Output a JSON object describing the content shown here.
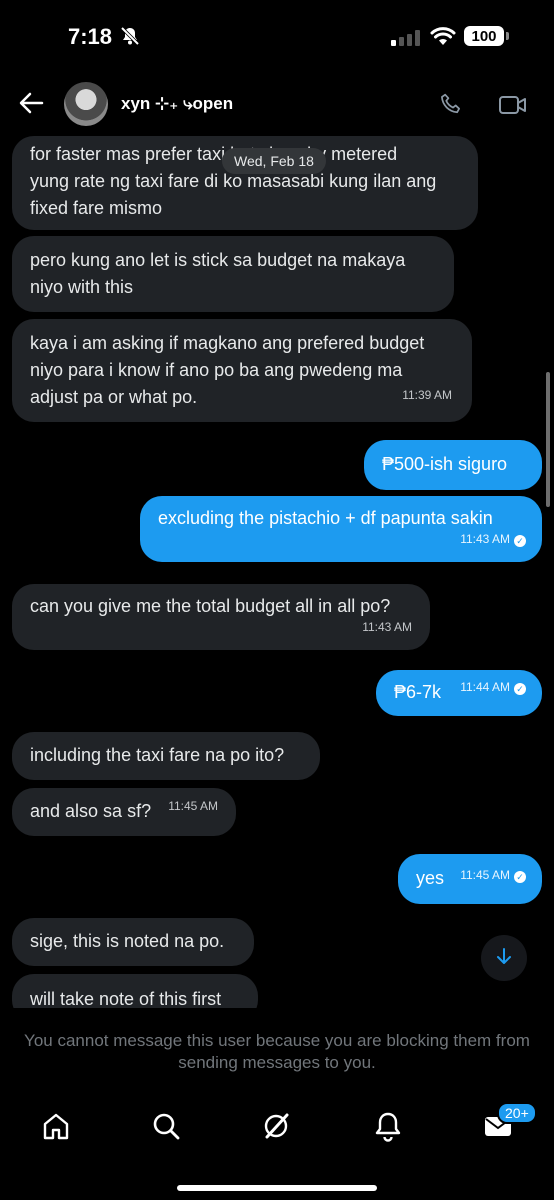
{
  "status": {
    "time": "7:18",
    "battery": "100"
  },
  "header": {
    "name": "xyn ⊹₊ ⤷open"
  },
  "date_divider": "Wed, Feb 18",
  "messages": [
    {
      "lines": [
        "for faster mas prefer taxi but since by metered",
        "yung rate ng taxi fare di ko masasabi kung ilan ang",
        "fixed fare mismo"
      ],
      "time": ""
    },
    {
      "lines": [
        "pero kung ano let is stick sa budget na makaya",
        "niyo with this"
      ],
      "time": ""
    },
    {
      "lines": [
        "kaya i am asking if magkano ang prefered budget",
        "niyo para i know if ano po ba ang pwedeng ma",
        "adjust pa or what po."
      ],
      "time": "11:39 AM"
    },
    {
      "lines": [
        "₱500-ish siguro"
      ],
      "time": ""
    },
    {
      "lines": [
        "excluding the pistachio + df papunta sakin"
      ],
      "time": "11:43 AM"
    },
    {
      "lines": [
        "can you give me the total budget all in all po?"
      ],
      "time": "11:43 AM"
    },
    {
      "lines": [
        "₱6-7k"
      ],
      "time": "11:44 AM"
    },
    {
      "lines": [
        "including the taxi fare na po ito?"
      ],
      "time": ""
    },
    {
      "lines": [
        "and also sa sf?"
      ],
      "time": "11:45 AM"
    },
    {
      "lines": [
        "yes"
      ],
      "time": "11:45 AM"
    },
    {
      "lines": [
        "sige, this is noted na po."
      ],
      "time": ""
    },
    {
      "lines": [
        "will take note of this first"
      ],
      "time": ""
    }
  ],
  "notice": "You cannot message this user because you are blocking them from sending messages to you.",
  "tabbar": {
    "messages_badge": "20+"
  },
  "colors": {
    "accent": "#1d9bf0",
    "received_bubble": "#202327",
    "background": "#000000"
  }
}
